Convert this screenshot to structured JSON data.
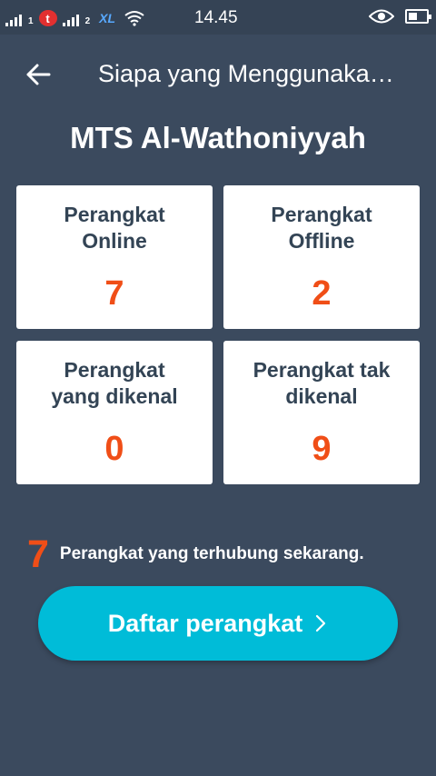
{
  "status_bar": {
    "sim1": "1",
    "sim2": "2",
    "carrier1_logo": "t",
    "carrier2_logo": "XL",
    "time": "14.45",
    "icons": [
      "signal-icon",
      "carrier-icon",
      "wifi-icon",
      "eye-icon",
      "battery-icon"
    ]
  },
  "header": {
    "title": "Siapa yang Menggunaka…"
  },
  "site": {
    "name": "MTS Al-Wathoniyyah"
  },
  "stats": [
    {
      "label": "Perangkat Online",
      "value": "7"
    },
    {
      "label": "Perangkat Offline",
      "value": "2"
    },
    {
      "label": "Perangkat yang dikenal",
      "value": "0"
    },
    {
      "label": "Perangkat tak dikenal",
      "value": "9"
    }
  ],
  "summary": {
    "count": "7",
    "text": "Perangkat yang terhubung sekarang."
  },
  "device_list_button": {
    "label": "Daftar perangkat"
  },
  "colors": {
    "background": "#3b4a5e",
    "accent": "#f04e17",
    "button": "#00bcd8"
  }
}
